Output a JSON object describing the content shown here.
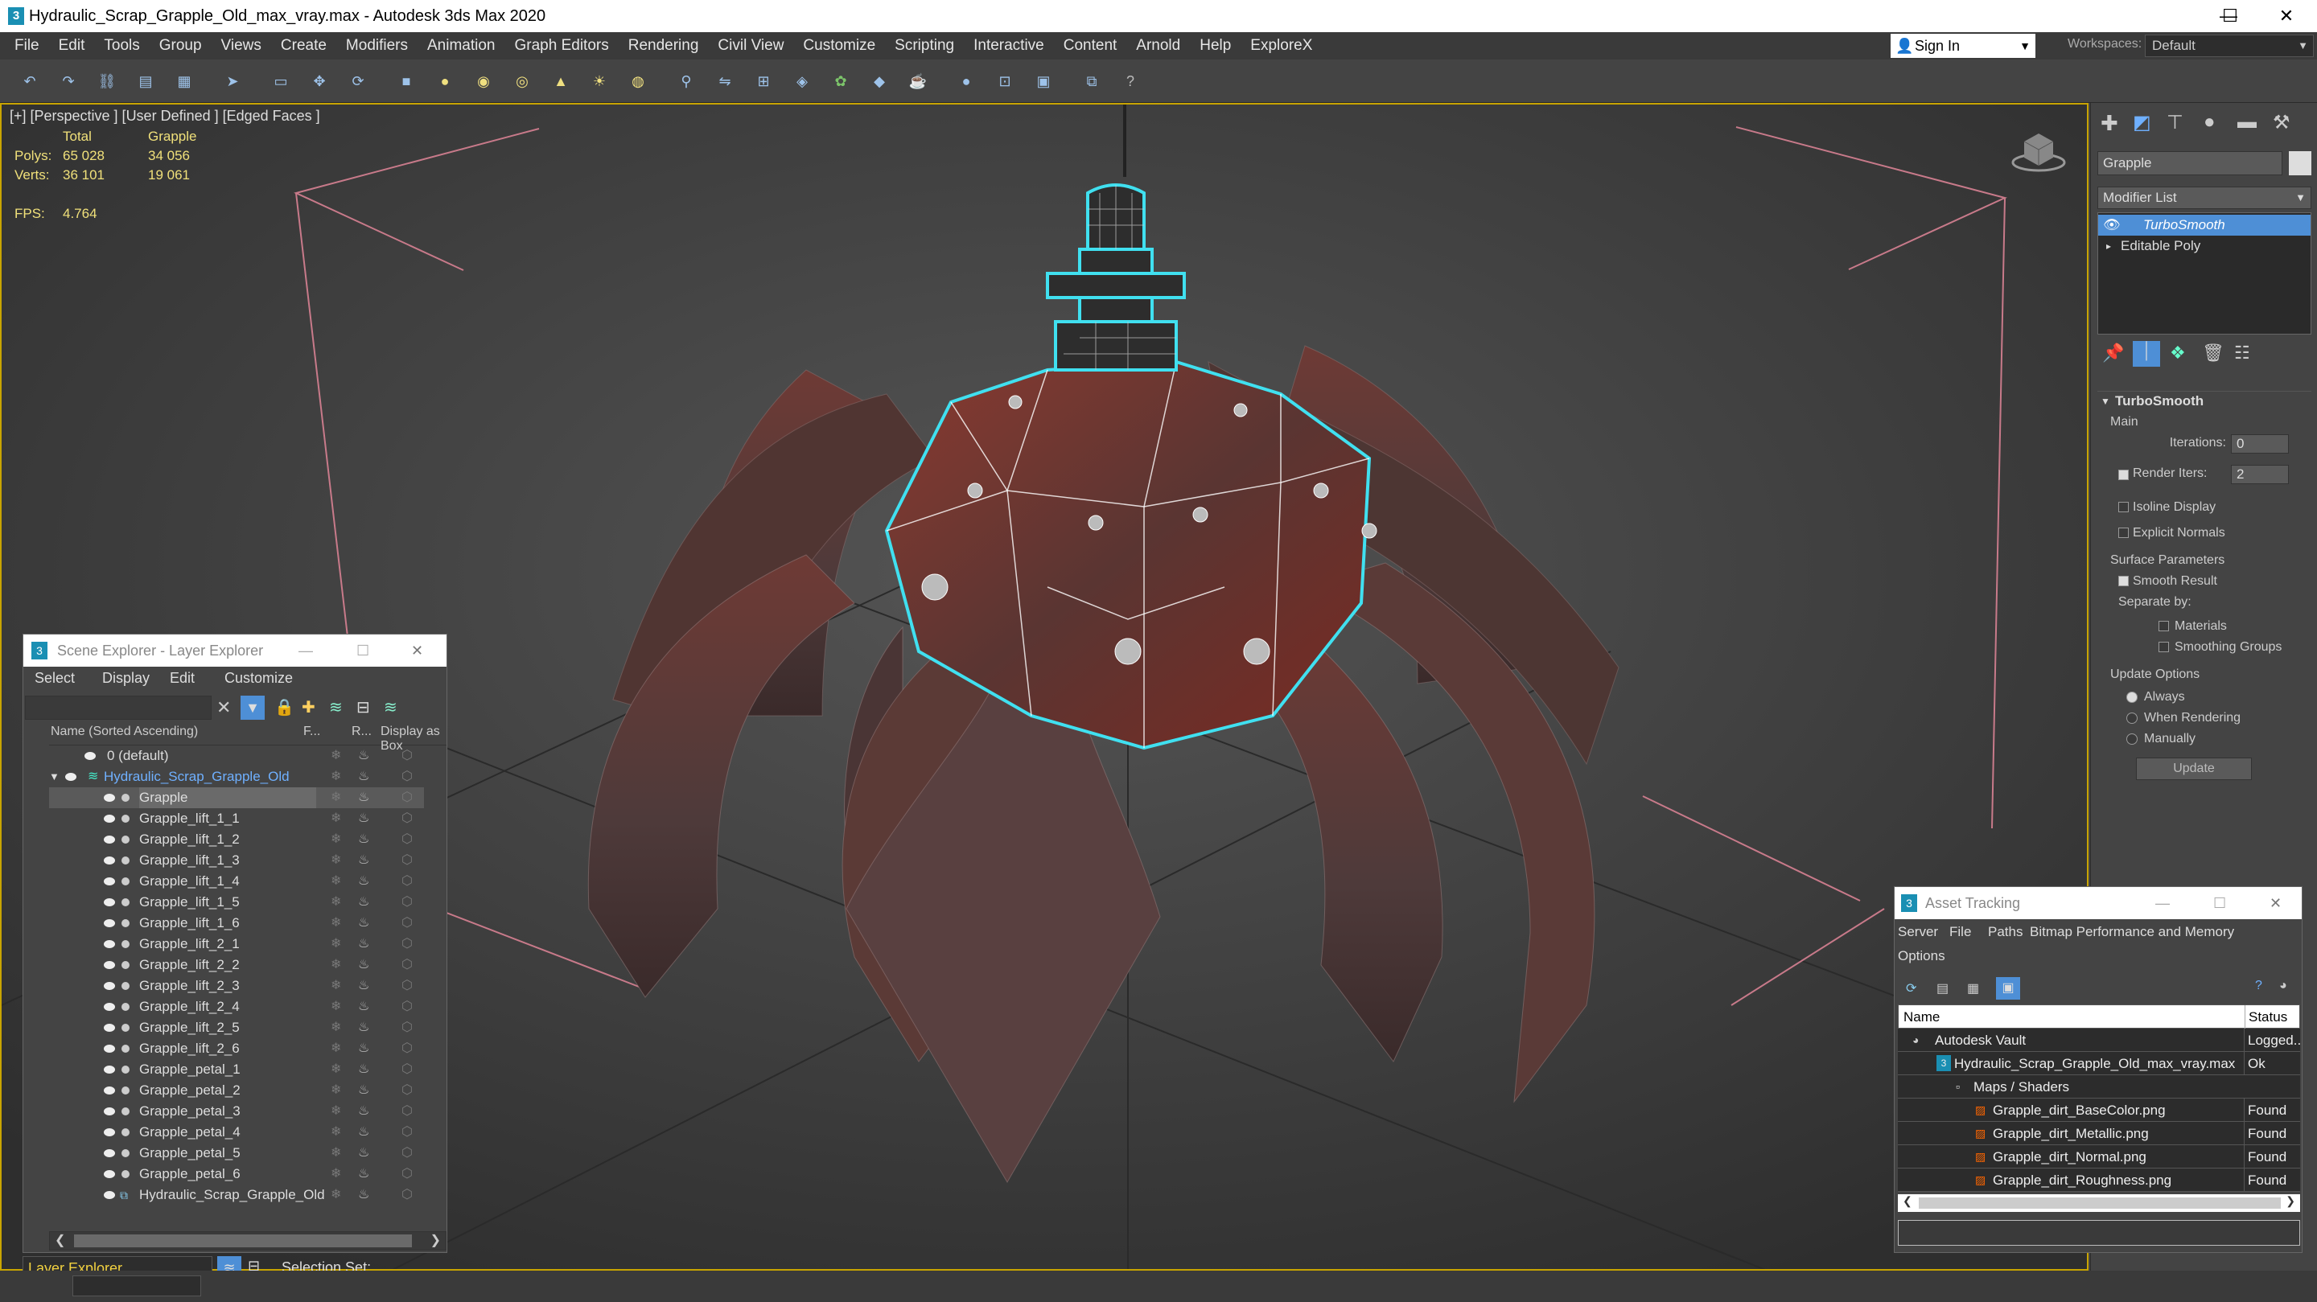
{
  "window": {
    "title": "Hydraulic_Scrap_Grapple_Old_max_vray.max - Autodesk 3ds Max 2020",
    "min": "—",
    "max": "☐",
    "close": "✕"
  },
  "menu": [
    "File",
    "Edit",
    "Tools",
    "Group",
    "Views",
    "Create",
    "Modifiers",
    "Animation",
    "Graph Editors",
    "Rendering",
    "Civil View",
    "Customize",
    "Scripting",
    "Interactive",
    "Content",
    "Arnold",
    "Help",
    "ExploreX"
  ],
  "signin": "Sign In",
  "workspaces_label": "Workspaces:",
  "workspace": "Default",
  "viewport": {
    "label": "[+] [Perspective ] [User Defined ] [Edged Faces ]",
    "stats": {
      "col_total": "Total",
      "col_sel": "Grapple",
      "polys_label": "Polys:",
      "polys_total": "65 028",
      "polys_sel": "34 056",
      "verts_label": "Verts:",
      "verts_total": "36 101",
      "verts_sel": "19 061",
      "fps_label": "FPS:",
      "fps": "4.764"
    }
  },
  "command": {
    "object_name": "Grapple",
    "modifier_list": "Modifier List",
    "stack": [
      "TurboSmooth",
      "Editable Poly"
    ],
    "rollout": "TurboSmooth",
    "main": "Main",
    "iterations_label": "Iterations:",
    "iterations": "0",
    "render_iters_label": "Render Iters:",
    "render_iters": "2",
    "isoline": "Isoline Display",
    "explicit": "Explicit Normals",
    "surface": "Surface Parameters",
    "smooth_result": "Smooth Result",
    "separate": "Separate by:",
    "materials": "Materials",
    "smoothing_groups": "Smoothing Groups",
    "update_options": "Update Options",
    "always": "Always",
    "when_rendering": "When Rendering",
    "manually": "Manually",
    "update_btn": "Update"
  },
  "scene_explorer": {
    "title": "Scene Explorer - Layer Explorer",
    "menu": [
      "Select",
      "Display",
      "Edit",
      "Customize"
    ],
    "col_name": "Name (Sorted Ascending)",
    "col_f": "F...",
    "col_r": "R...",
    "col_box": "Display as Box",
    "rows": [
      "0 (default)",
      "Hydraulic_Scrap_Grapple_Old",
      "Grapple",
      "Grapple_lift_1_1",
      "Grapple_lift_1_2",
      "Grapple_lift_1_3",
      "Grapple_lift_1_4",
      "Grapple_lift_1_5",
      "Grapple_lift_1_6",
      "Grapple_lift_2_1",
      "Grapple_lift_2_2",
      "Grapple_lift_2_3",
      "Grapple_lift_2_4",
      "Grapple_lift_2_5",
      "Grapple_lift_2_6",
      "Grapple_petal_1",
      "Grapple_petal_2",
      "Grapple_petal_3",
      "Grapple_petal_4",
      "Grapple_petal_5",
      "Grapple_petal_6",
      "Hydraulic_Scrap_Grapple_Old"
    ],
    "footer_explorer": "Layer Explorer",
    "selection_set": "Selection Set:"
  },
  "asset_tracking": {
    "title": "Asset Tracking",
    "menu": [
      "Server",
      "File",
      "Paths",
      "Bitmap Performance and Memory"
    ],
    "options": "Options",
    "col_name": "Name",
    "col_status": "Status",
    "rows": [
      {
        "name": "Autodesk Vault",
        "status": "Logged..."
      },
      {
        "name": "Hydraulic_Scrap_Grapple_Old_max_vray.max",
        "status": "Ok"
      },
      {
        "name": "Maps / Shaders",
        "status": ""
      },
      {
        "name": "Grapple_dirt_BaseColor.png",
        "status": "Found"
      },
      {
        "name": "Grapple_dirt_Metallic.png",
        "status": "Found"
      },
      {
        "name": "Grapple_dirt_Normal.png",
        "status": "Found"
      },
      {
        "name": "Grapple_dirt_Roughness.png",
        "status": "Found"
      }
    ]
  },
  "colors": {
    "accent": "#5a8ad6",
    "selection": "#4e8fd6",
    "wire_select": "#40e0f0",
    "rust": "#7a2a22"
  }
}
